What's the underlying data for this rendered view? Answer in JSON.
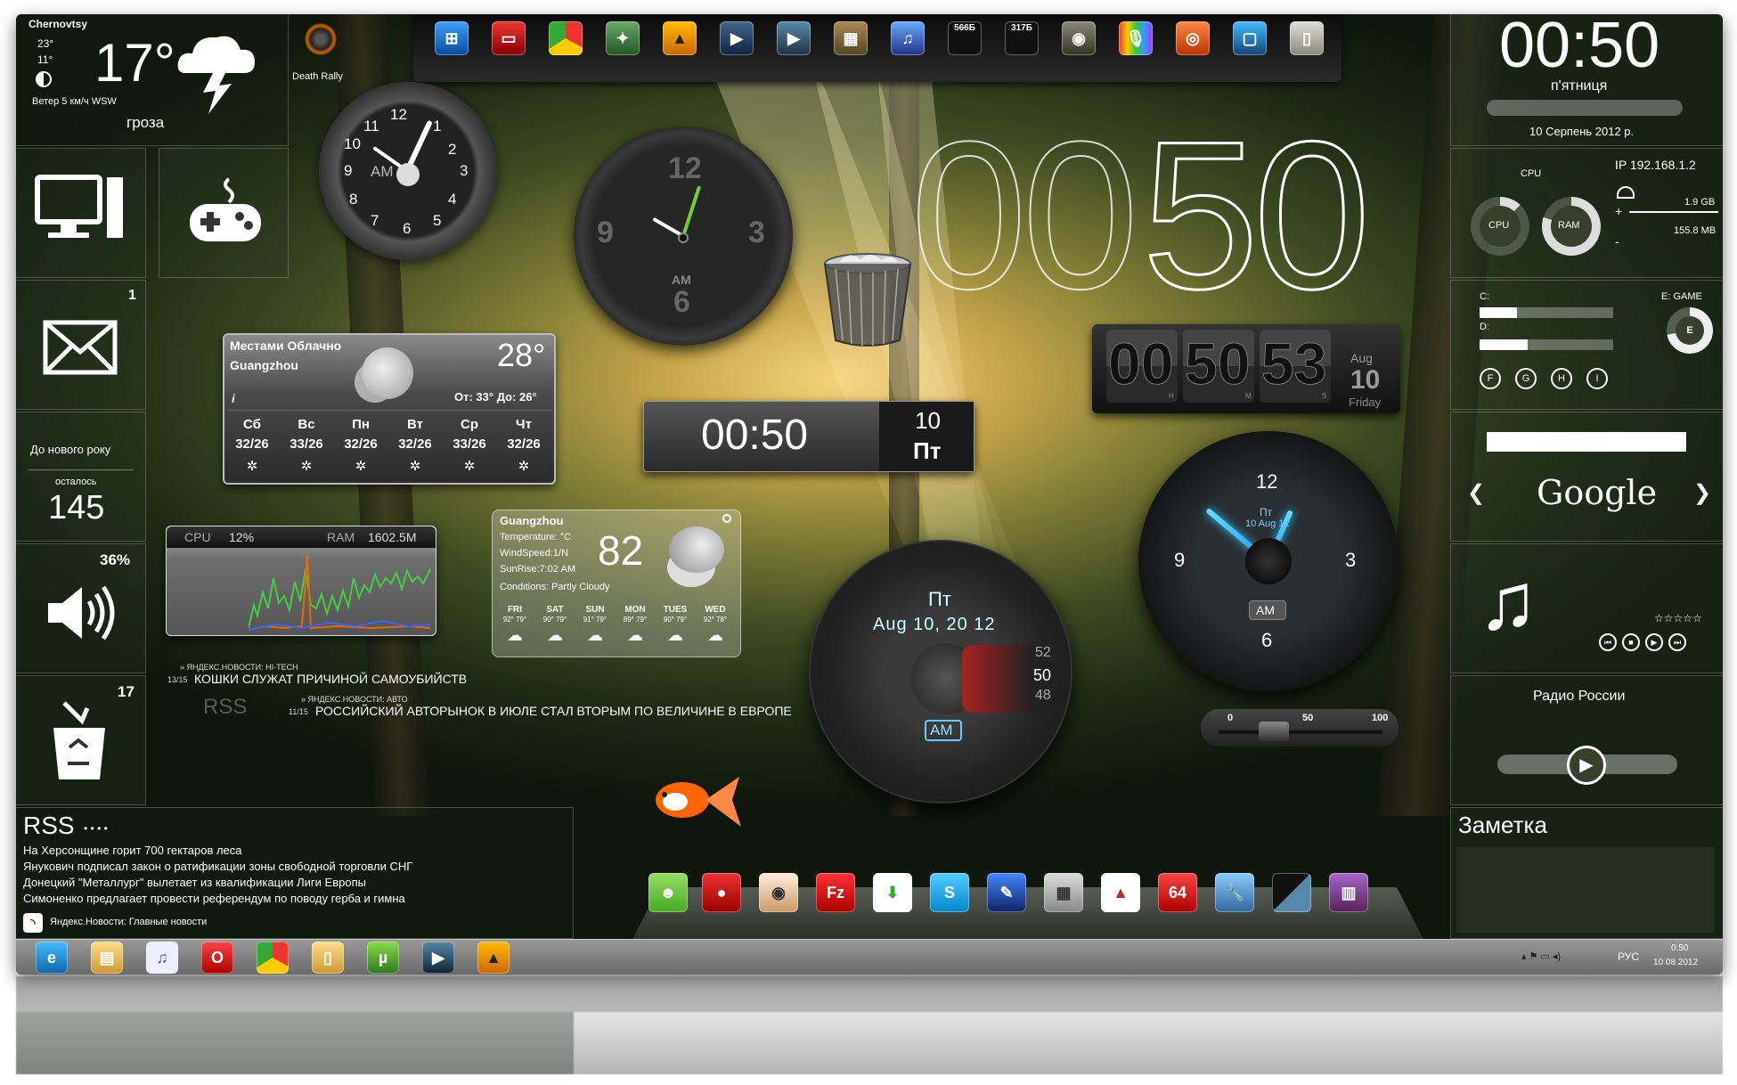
{
  "weather_top": {
    "city": "Chernovtsy",
    "hi": "23°",
    "lo": "11°",
    "temp": "17°",
    "wind": "Ветер  5 км/ч  WSW",
    "cond": "гроза"
  },
  "game_shortcut": {
    "label": "Death Rally"
  },
  "dock_top": {
    "badge1": "566Б",
    "badge2": "317Б"
  },
  "big_clock": {
    "h": "00",
    "m": "50"
  },
  "right_clock": {
    "time": "00:50",
    "day": "п'ятниця",
    "date": "10 Серпень 2012 р."
  },
  "sysmon": {
    "cpu_label": "CPU",
    "ip": "IP 192.168.1.2",
    "cpu": "CPU",
    "ram": "RAM",
    "mem1": "1.9 GB",
    "mem2": "155.8 MB"
  },
  "drives": {
    "c": "C:",
    "d": "D:",
    "e": "E: GAME",
    "e_letter": "E",
    "buttons": [
      "F",
      "G",
      "H",
      "I"
    ]
  },
  "google": {
    "logo": "Google",
    "prev": "❮",
    "next": "❯"
  },
  "music": {
    "stars": "☆☆☆☆☆"
  },
  "radio": {
    "title": "Радио России"
  },
  "note": {
    "title": "Заметка"
  },
  "mail": {
    "badge": "1"
  },
  "countdown": {
    "title": "До нового року",
    "sub": "осталось",
    "days": "145"
  },
  "volume": {
    "pct": "36%"
  },
  "recycle": {
    "badge": "17"
  },
  "clock_am": {
    "am": "AM",
    "nums": [
      "12",
      "1",
      "2",
      "3",
      "4",
      "5",
      "6",
      "7",
      "8",
      "9",
      "10",
      "11"
    ]
  },
  "clock_dark": {
    "n12": "12",
    "n3": "3",
    "n6": "6",
    "n9": "9",
    "am": "AM"
  },
  "weather_cn": {
    "cond": "Местами Облачно",
    "city": "Guangzhou",
    "temp": "28°",
    "range": "От: 33° До: 26°",
    "info": "i",
    "days": [
      {
        "d": "Сб",
        "t": "32/26"
      },
      {
        "d": "Вс",
        "t": "33/26"
      },
      {
        "d": "Пн",
        "t": "32/26"
      },
      {
        "d": "Вт",
        "t": "32/26"
      },
      {
        "d": "Ср",
        "t": "33/26"
      },
      {
        "d": "Чт",
        "t": "32/26"
      }
    ]
  },
  "digital_clock": {
    "time": "00:50",
    "day": "10",
    "wd": "Пт"
  },
  "flip_clock": {
    "h": "00",
    "m": "50",
    "s": "53",
    "hl": "H",
    "ml": "M",
    "sl": "S",
    "month": "Aug",
    "day": "10",
    "wd": "Friday"
  },
  "cpu_graph": {
    "cpu_label": "CPU",
    "cpu": "12%",
    "ram_label": "RAM",
    "ram": "1602.5M"
  },
  "weather_gz": {
    "city": "Guangzhou",
    "temp": "82",
    "l1": "Temperature: °C",
    "l2": "WindSpeed:1/N",
    "l3": "SunRise:7:02 AM",
    "l4": "Conditions: Partly Cloudy",
    "days": [
      {
        "d": "FRI",
        "t": "92° 79°"
      },
      {
        "d": "SAT",
        "t": "90° 79°"
      },
      {
        "d": "SUN",
        "t": "91° 79°"
      },
      {
        "d": "MON",
        "t": "89° 79°"
      },
      {
        "d": "TUES",
        "t": "90° 79°"
      },
      {
        "d": "WED",
        "t": "92° 78°"
      }
    ]
  },
  "round_clock": {
    "wd": "Пт",
    "date": "Aug  10, 20 12",
    "am": "AM",
    "m1": "52",
    "m2": "50",
    "m3": "48"
  },
  "blue_clock": {
    "n12": "12",
    "n3": "3",
    "n6": "6",
    "n9": "9",
    "inner": "Пт",
    "inner2": "10 Aug 12",
    "am": "AM"
  },
  "slider": {
    "s0": "0",
    "s50": "50",
    "s100": "100",
    "value": 0.3
  },
  "news": {
    "src1": "» ЯНДЕКС.НОВОСТИ: HI-TECH",
    "t1": "13/15",
    "h1": "КОШКИ СЛУЖАТ ПРИЧИНОЙ САМОУБИЙСТВ",
    "src2": "» ЯНДЕКС.НОВОСТИ: АВТО",
    "t2": "11/15",
    "h2": "РОССИЙСКИЙ АВТОРЫНОК В ИЮЛЕ СТАЛ ВТОРЫМ ПО ВЕЛИЧИНЕ В ЕВРОПЕ",
    "rss": "RSS"
  },
  "rss": {
    "title": "RSS",
    "dots": "• • • •",
    "items": [
      "На Херсонщине горит 700 гектаров леса",
      "Янукович подписал закон о ратификации зоны свободной торговли СНГ",
      "Донецкий \"Металлург\" вылетает из квалификации Лиги Европы",
      "Симоненко предлагает провести референдум по поводу герба и гимна"
    ],
    "source": "Яндекс.Новости: Главные новости"
  },
  "taskbar": {
    "lang": "РУС",
    "time": "0:50",
    "date": "10.08.2012"
  },
  "dock_bottom": {
    "badge": "64"
  }
}
